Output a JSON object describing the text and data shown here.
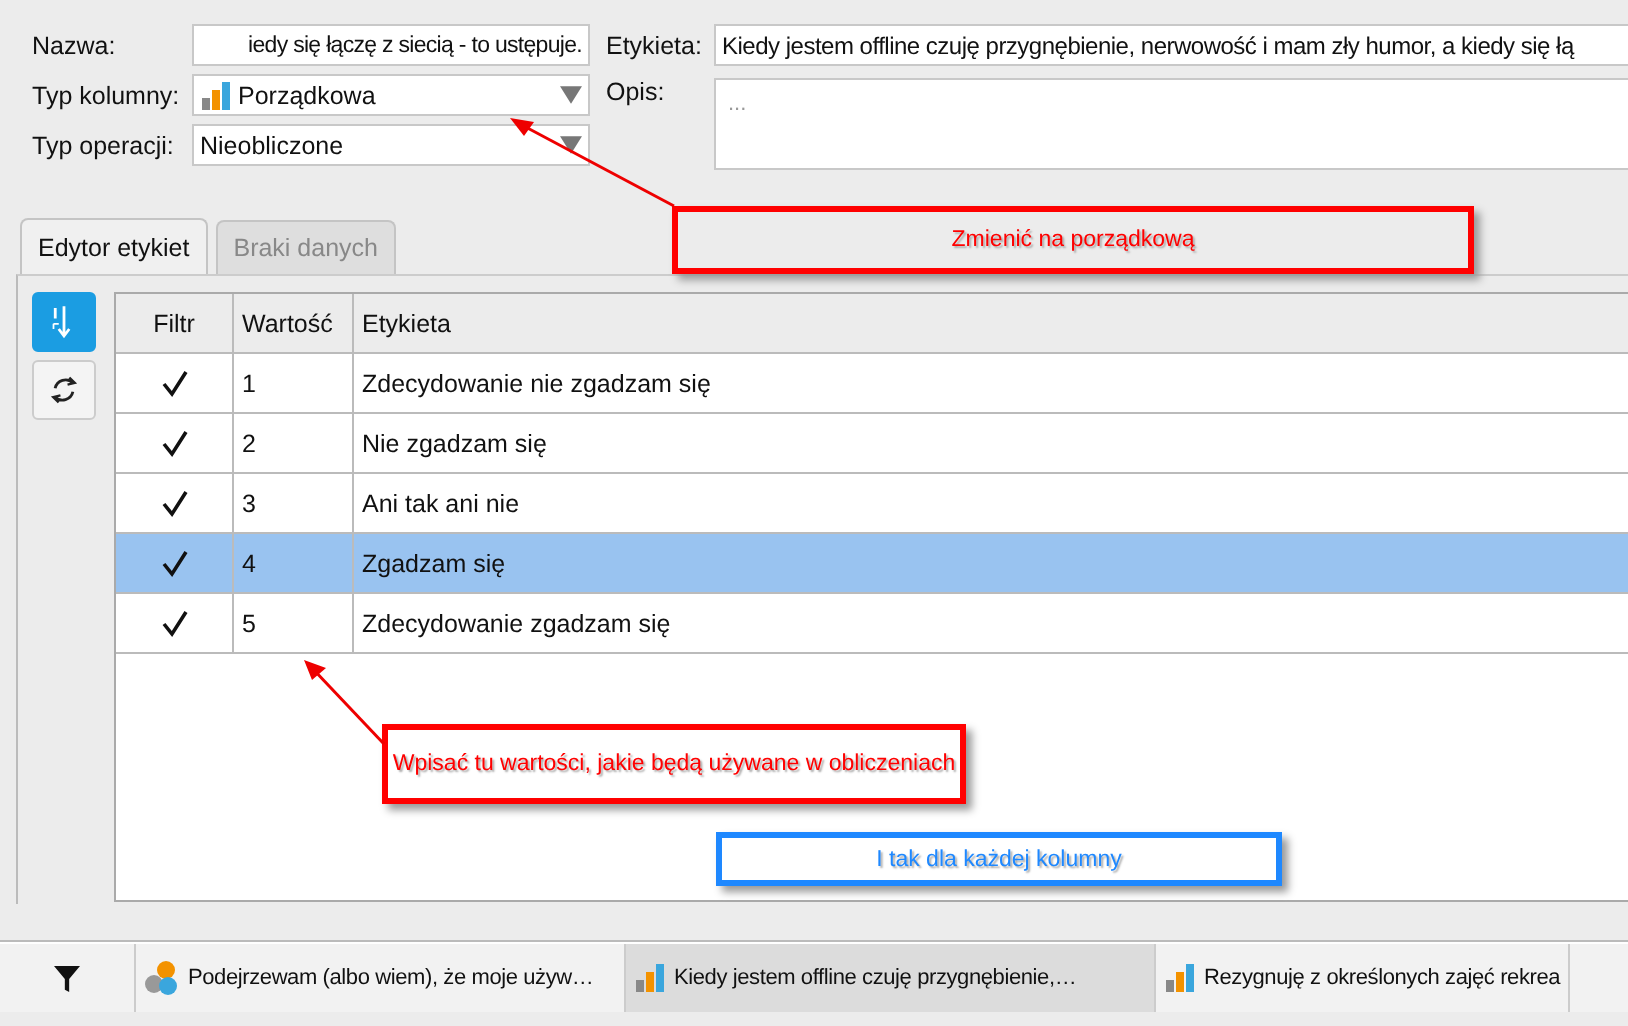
{
  "form": {
    "name_label": "Nazwa:",
    "name_value": "iedy się łączę z siecią - to ustępuje.",
    "label_label": "Etykieta:",
    "label_value": "Kiedy jestem offline czuję przygnębienie, nerwowość i mam zły humor, a kiedy się łą",
    "column_type_label": "Typ kolumny:",
    "column_type_value": "Porządkowa",
    "operation_type_label": "Typ operacji:",
    "operation_type_value": "Nieobliczone",
    "description_label": "Opis:",
    "description_placeholder": "..."
  },
  "tabs": [
    {
      "label": "Edytor etykiet",
      "selected": true
    },
    {
      "label": "Braki danych",
      "selected": false
    }
  ],
  "side_buttons": [
    {
      "kind": "sort",
      "selected": true
    },
    {
      "kind": "renumber",
      "selected": false
    }
  ],
  "table": {
    "columns": [
      "Filtr",
      "Wartość",
      "Etykieta"
    ],
    "rows": [
      {
        "checked": true,
        "value": "1",
        "label": "Zdecydowanie nie zgadzam się",
        "selected": false
      },
      {
        "checked": true,
        "value": "2",
        "label": "Nie zgadzam się",
        "selected": false
      },
      {
        "checked": true,
        "value": "3",
        "label": "Ani tak ani nie",
        "selected": false
      },
      {
        "checked": true,
        "value": "4",
        "label": "Zgadzam się",
        "selected": true
      },
      {
        "checked": true,
        "value": "5",
        "label": "Zdecydowanie zgadzam się",
        "selected": false
      }
    ]
  },
  "annotations": [
    {
      "text": "Zmienić na porządkową",
      "color": "#ff0000"
    },
    {
      "text": "Wpisać tu wartości, jakie będą używane w obliczeniach",
      "color": "#ff0000"
    },
    {
      "text": "I tak dla każdej kolumny",
      "color": "#1e88ff"
    }
  ],
  "bottom_tabs": [
    {
      "label": "Podejrzewam (albo wiem), że moje używ…",
      "kind": "nominal",
      "selected": false
    },
    {
      "label": "Kiedy jestem offline czuję przygnębienie,…",
      "kind": "ordinal",
      "selected": true
    },
    {
      "label": "Rezygnuję z określonych zajęć rekrea",
      "kind": "ordinal",
      "selected": false
    }
  ]
}
